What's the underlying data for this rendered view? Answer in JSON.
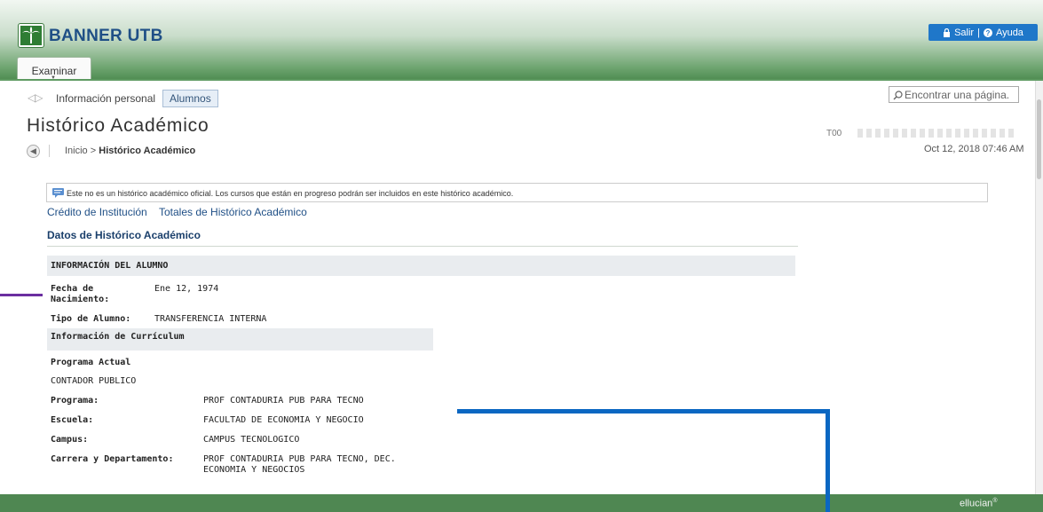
{
  "app": {
    "brand": "BANNER UTB",
    "salir_label": "Salir",
    "ayuda_label": "Ayuda",
    "examinar_label": "Examinar"
  },
  "nav": {
    "info_personal": "Información personal",
    "alumnos": "Alumnos",
    "search_placeholder": "Encontrar una página."
  },
  "page": {
    "title": "Histórico Académico",
    "breadcrumb_home": "Inicio",
    "breadcrumb_sep": ">",
    "breadcrumb_current": "Histórico Académico",
    "user_id_prefix": "T00",
    "timestamp": "Oct 12, 2018 07:46 AM"
  },
  "notice": {
    "text": "Este no es un histórico académico oficial. Los cursos que están en progreso podrán ser incluidos en este histórico académico."
  },
  "links": {
    "credito": "Crédito de Institución",
    "totales": "Totales de Histórico Académico"
  },
  "section": {
    "title": "Datos de Histórico Académico",
    "student_info_header": "INFORMACIÓN DEL ALUMNO",
    "fecha_label_1": "Fecha de",
    "fecha_label_2": "Nacimiento:",
    "fecha_value": "Ene 12, 1974",
    "tipo_label": "Tipo de Alumno:",
    "tipo_value": "TRANSFERENCIA INTERNA",
    "curriculum_header": "Información de Currículum",
    "programa_actual_label": "Programa Actual",
    "programa_actual_value": "CONTADOR PUBLICO",
    "rows": [
      {
        "label": "Programa:",
        "value": "PROF CONTADURIA PUB PARA TECNO"
      },
      {
        "label": "Escuela:",
        "value": "FACULTAD DE ECONOMIA Y NEGOCIO"
      },
      {
        "label": "Campus:",
        "value": "CAMPUS TECNOLOGICO"
      },
      {
        "label": "Carrera y Departamento:",
        "value": "PROF CONTADURIA PUB PARA TECNO, DEC.",
        "value2": "ECONOMIA Y NEGOCIOS"
      }
    ]
  },
  "footer": {
    "brand": "ellucian",
    "brand_mark": "®"
  },
  "colors": {
    "header_green": "#4e8c51",
    "link_blue": "#1f4f86",
    "button_blue": "#1f77c9",
    "annotation_purple": "#6b2fa0",
    "annotation_blue": "#0a67c2"
  },
  "icons": [
    "palm-logo-icon",
    "lock-icon",
    "help-icon",
    "chevron-down-icon",
    "nav-back-forward-icon",
    "search-icon",
    "back-arrow-icon",
    "comment-icon"
  ]
}
